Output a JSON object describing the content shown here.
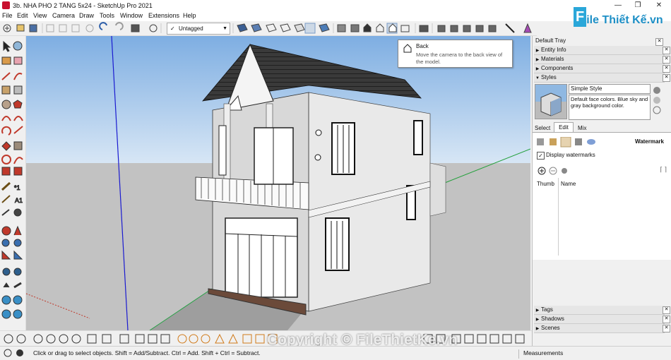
{
  "window": {
    "title": "3b. NHA PHO 2 TANG 5x24 - SketchUp Pro 2021",
    "minimize": "—",
    "restore": "❐",
    "close": "✕"
  },
  "menu": [
    "File",
    "Edit",
    "View",
    "Camera",
    "Draw",
    "Tools",
    "Window",
    "Extensions",
    "Help"
  ],
  "logo": {
    "f": "F",
    "text": "ile Thiết Kế.vn"
  },
  "toolbar": {
    "tag_selected": "Untagged",
    "tag_check": "✓"
  },
  "tooltip": {
    "title": "Back",
    "description": "Move the camera to the back view of the model."
  },
  "tray": {
    "title": "Default Tray",
    "sections": {
      "entity_info": "Entity Info",
      "materials": "Materials",
      "components": "Components",
      "styles": "Styles",
      "tags": "Tags",
      "shadows": "Shadows",
      "scenes": "Scenes"
    },
    "style_name": "Simple Style",
    "style_desc": "Default face colors. Blue sky and gray background color.",
    "tabs": [
      "Select",
      "Edit",
      "Mix"
    ],
    "edit_section": "Watermark",
    "display_watermarks": "Display watermarks",
    "columns": [
      "Thumb",
      "Name"
    ]
  },
  "status": {
    "hint": "Click or drag to select objects. Shift = Add/Subtract. Ctrl = Add. Shift + Ctrl = Subtract.",
    "measurements": "Measurements"
  },
  "watermark": "Copyright © FileThietKe.vn",
  "colors": {
    "sky": "#a9c8ea",
    "ground": "#bfbfbf",
    "accent": "#1d8fc6"
  }
}
